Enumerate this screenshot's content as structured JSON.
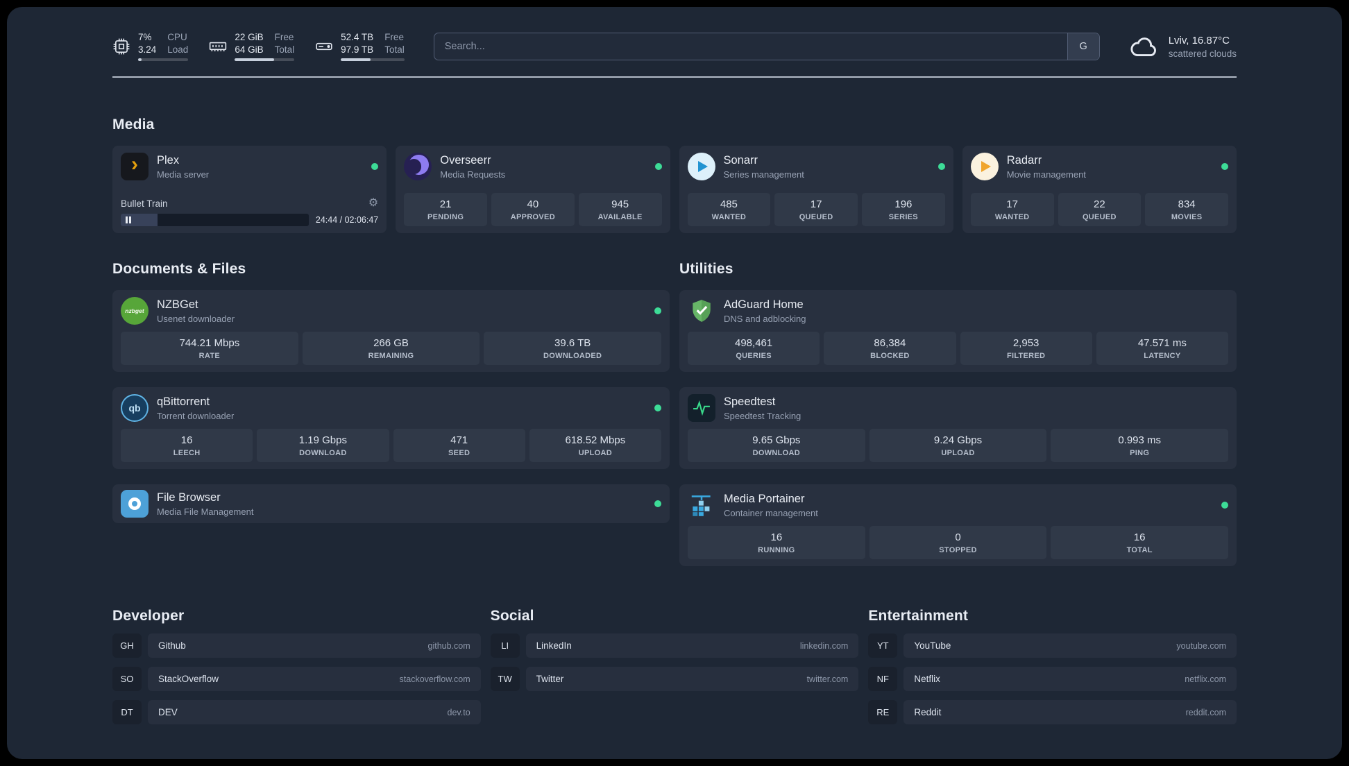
{
  "colors": {
    "status_online": "#3ddc97",
    "plex_accent": "#e5a00d",
    "page_background": "#1e2735",
    "card_background": "#28303f"
  },
  "topbar": {
    "resources": [
      {
        "icon": "cpu-icon",
        "values": [
          "7%",
          "3.24"
        ],
        "labels": [
          "CPU",
          "Load"
        ],
        "progress": 7
      },
      {
        "icon": "memory-icon",
        "values": [
          "22 GiB",
          "64 GiB"
        ],
        "labels": [
          "Free",
          "Total"
        ],
        "progress": 66
      },
      {
        "icon": "disk-icon",
        "values": [
          "52.4 TB",
          "97.9 TB"
        ],
        "labels": [
          "Free",
          "Total"
        ],
        "progress": 47
      }
    ],
    "search": {
      "placeholder": "Search...",
      "provider_button": "G"
    },
    "weather": {
      "location_temp": "Lviv, 16.87°C",
      "condition": "scattered clouds"
    }
  },
  "media": {
    "title": "Media",
    "cards": [
      {
        "name": "Plex",
        "desc": "Media server",
        "status": "online",
        "player": {
          "track": "Bullet Train",
          "time": "24:44 / 02:06:47",
          "progress": 19.5
        }
      },
      {
        "name": "Overseerr",
        "desc": "Media Requests",
        "status": "online",
        "stats": [
          {
            "value": "21",
            "label": "PENDING"
          },
          {
            "value": "40",
            "label": "APPROVED"
          },
          {
            "value": "945",
            "label": "AVAILABLE"
          }
        ]
      },
      {
        "name": "Sonarr",
        "desc": "Series management",
        "status": "online",
        "stats": [
          {
            "value": "485",
            "label": "WANTED"
          },
          {
            "value": "17",
            "label": "QUEUED"
          },
          {
            "value": "196",
            "label": "SERIES"
          }
        ]
      },
      {
        "name": "Radarr",
        "desc": "Movie management",
        "status": "online",
        "stats": [
          {
            "value": "17",
            "label": "WANTED"
          },
          {
            "value": "22",
            "label": "QUEUED"
          },
          {
            "value": "834",
            "label": "MOVIES"
          }
        ]
      }
    ]
  },
  "documents": {
    "title": "Documents & Files",
    "cards": [
      {
        "name": "NZBGet",
        "desc": "Usenet downloader",
        "status": "online",
        "stats": [
          {
            "value": "744.21 Mbps",
            "label": "RATE"
          },
          {
            "value": "266 GB",
            "label": "REMAINING"
          },
          {
            "value": "39.6 TB",
            "label": "DOWNLOADED"
          }
        ]
      },
      {
        "name": "qBittorrent",
        "desc": "Torrent downloader",
        "status": "online",
        "stats": [
          {
            "value": "16",
            "label": "LEECH"
          },
          {
            "value": "1.19 Gbps",
            "label": "DOWNLOAD"
          },
          {
            "value": "471",
            "label": "SEED"
          },
          {
            "value": "618.52 Mbps",
            "label": "UPLOAD"
          }
        ]
      },
      {
        "name": "File Browser",
        "desc": "Media File Management",
        "status": "online",
        "stats": []
      }
    ]
  },
  "utilities": {
    "title": "Utilities",
    "cards": [
      {
        "name": "AdGuard Home",
        "desc": "DNS and adblocking",
        "status": "none",
        "stats": [
          {
            "value": "498,461",
            "label": "QUERIES"
          },
          {
            "value": "86,384",
            "label": "BLOCKED"
          },
          {
            "value": "2,953",
            "label": "FILTERED"
          },
          {
            "value": "47.571 ms",
            "label": "LATENCY"
          }
        ]
      },
      {
        "name": "Speedtest",
        "desc": "Speedtest Tracking",
        "status": "none",
        "stats": [
          {
            "value": "9.65 Gbps",
            "label": "DOWNLOAD"
          },
          {
            "value": "9.24 Gbps",
            "label": "UPLOAD"
          },
          {
            "value": "0.993 ms",
            "label": "PING"
          }
        ]
      },
      {
        "name": "Media Portainer",
        "desc": "Container management",
        "status": "online",
        "stats": [
          {
            "value": "16",
            "label": "RUNNING"
          },
          {
            "value": "0",
            "label": "STOPPED"
          },
          {
            "value": "16",
            "label": "TOTAL"
          }
        ]
      }
    ]
  },
  "bookmarks": {
    "groups": [
      {
        "title": "Developer",
        "items": [
          {
            "abbr": "GH",
            "name": "Github",
            "url": "github.com"
          },
          {
            "abbr": "SO",
            "name": "StackOverflow",
            "url": "stackoverflow.com"
          },
          {
            "abbr": "DT",
            "name": "DEV",
            "url": "dev.to"
          }
        ]
      },
      {
        "title": "Social",
        "items": [
          {
            "abbr": "LI",
            "name": "LinkedIn",
            "url": "linkedin.com"
          },
          {
            "abbr": "TW",
            "name": "Twitter",
            "url": "twitter.com"
          }
        ]
      },
      {
        "title": "Entertainment",
        "items": [
          {
            "abbr": "YT",
            "name": "YouTube",
            "url": "youtube.com"
          },
          {
            "abbr": "NF",
            "name": "Netflix",
            "url": "netflix.com"
          },
          {
            "abbr": "RE",
            "name": "Reddit",
            "url": "reddit.com"
          }
        ]
      }
    ]
  }
}
